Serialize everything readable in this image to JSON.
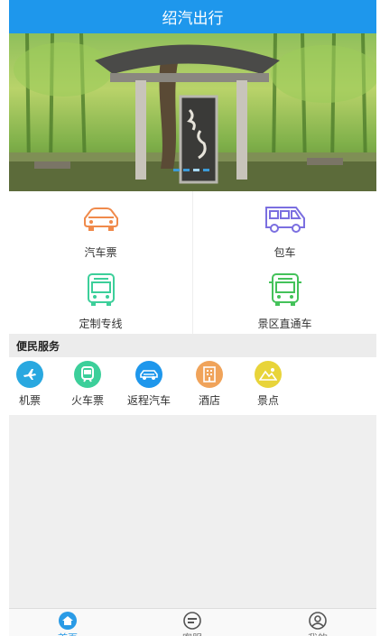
{
  "header": {
    "title": "绍汽出行"
  },
  "banner": {
    "slide_count": 4,
    "active_slide": 2
  },
  "services": [
    {
      "label": "汽车票",
      "icon": "car-icon",
      "color": "#f08a4b"
    },
    {
      "label": "包车",
      "icon": "bus-icon",
      "color": "#7b6fe0"
    },
    {
      "label": "定制专线",
      "icon": "bus-front-icon",
      "color": "#3ccf9a"
    },
    {
      "label": "景区直通车",
      "icon": "bus-front-icon",
      "color": "#44c25a"
    }
  ],
  "convenience": {
    "title": "便民服务",
    "items": [
      {
        "label": "机票",
        "icon": "plane-icon",
        "color": "#29a8e0"
      },
      {
        "label": "火车票",
        "icon": "train-icon",
        "color": "#3ccf9a"
      },
      {
        "label": "返程汽车",
        "icon": "return-car-icon",
        "color": "#1e97ec"
      },
      {
        "label": "酒店",
        "icon": "hotel-icon",
        "color": "#f0a35a"
      },
      {
        "label": "景点",
        "icon": "scenic-icon",
        "color": "#e8d43a"
      }
    ]
  },
  "tabbar": {
    "items": [
      {
        "label": "首页",
        "icon": "home-icon",
        "active": true
      },
      {
        "label": "客服",
        "icon": "message-icon",
        "active": false
      },
      {
        "label": "我的",
        "icon": "user-icon",
        "active": false
      }
    ]
  },
  "colors": {
    "primary": "#1e97ec"
  }
}
